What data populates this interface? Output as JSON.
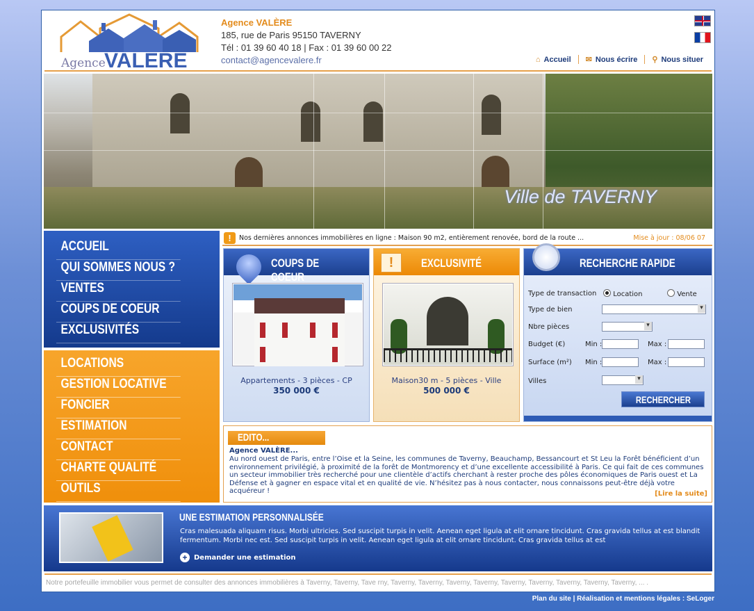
{
  "header": {
    "logo_agence": "Agence",
    "logo_valere": "VALERE",
    "agency_name": "Agence VALÈRE",
    "address": "185, rue de Paris 95150 TAVERNY",
    "phone": " Tél : 01 39 60 40 18 | Fax : 01 39 60 00 22",
    "email": "contact@agencevalere.fr",
    "nav": {
      "home": "Accueil",
      "write": "Nous écrire",
      "locate": "Nous situer"
    },
    "icons": {
      "home": "home-icon",
      "write": "envelope-icon",
      "locate": "magnifier-icon"
    }
  },
  "banner": {
    "caption": "Ville de TAVERNY"
  },
  "nav_blue": [
    "ACCUEIL",
    "QUI SOMMES NOUS ?",
    "VENTES",
    "COUPS DE COEUR",
    "EXCLUSIVITÉS"
  ],
  "nav_orange": [
    "LOCATIONS",
    "GESTION LOCATIVE",
    "FONCIER",
    "ESTIMATION",
    "CONTACT",
    "CHARTE QUALITÉ",
    "OUTILS"
  ],
  "ticker": {
    "message": "Nos dernières annonces immobilières en ligne : Maison 90 m2, entièrement renovée, bord de la route ...",
    "update": "Mise à jour : 08/06 07"
  },
  "coups_de_coeur": {
    "title": "COUPS DE COEUR",
    "desc": "Appartements - 3 pièces - CP",
    "price": "350 000 €"
  },
  "exclusivite": {
    "title": "EXCLUSIVITÉ",
    "desc": "Maison30 m - 5 pièces - Ville",
    "price": "500 000 €"
  },
  "search": {
    "title": "RECHERCHE RAPIDE",
    "transaction_label": "Type de transaction",
    "opt_location": "Location",
    "opt_vente": "Vente",
    "type_label": "Type de bien",
    "rooms_label": "Nbre pièces",
    "budget_label": "Budget (€)",
    "surface_label": "Surface (m²)",
    "min_label": "Min :",
    "max_label": "Max :",
    "villes_label": "Villes",
    "button": "RECHERCHER"
  },
  "edito": {
    "tag": "EDITO...",
    "heading": "Agence VALÈRE...",
    "text": "Au nord ouest de Paris, entre l’Oise et la Seine, les communes de Taverny, Beauchamp, Bessancourt et St Leu la Forêt bénéficient d’un environnement privilégié, à proximité de la forêt de Montmorency et d’une excellente accessibilité à Paris. Ce qui fait de ces communes un secteur immobilier très recherché pour une clientèle d’actifs cherchant à rester proche des pôles économiques de Paris ouest et La Défense et à gagner en espace vital et en qualité de vie. N’hésitez pas à nous contacter, nous connaissons peut-être déjà votre acquéreur !",
    "more": "[Lire la suite]"
  },
  "estimation": {
    "title": "UNE ESTIMATION PERSONNALISÉE",
    "text": "Cras malesuada aliquam risus. Morbi ultricies. Sed suscipit turpis in velit. Aenean eget ligula at elit ornare tincidunt. Cras gravida tellus at est blandit fermentum. Morbi nec est. Sed suscipit turpis in velit. Aenean eget ligula at elit ornare tincidunt. Cras gravida tellus at est",
    "ask": "Demander une estimation"
  },
  "footer": {
    "text": "Notre portefeuille immobilier vous permet de consulter des annonces immobilières à Taverny, Taverny, Tave rny, Taverny, Taverny, Taverny, Taverny, Taverny, Taverny, Taverny, Taverny, Taverny, ... .",
    "links": "Plan du site  |  Réalisation et mentions légales : SeLoger"
  }
}
